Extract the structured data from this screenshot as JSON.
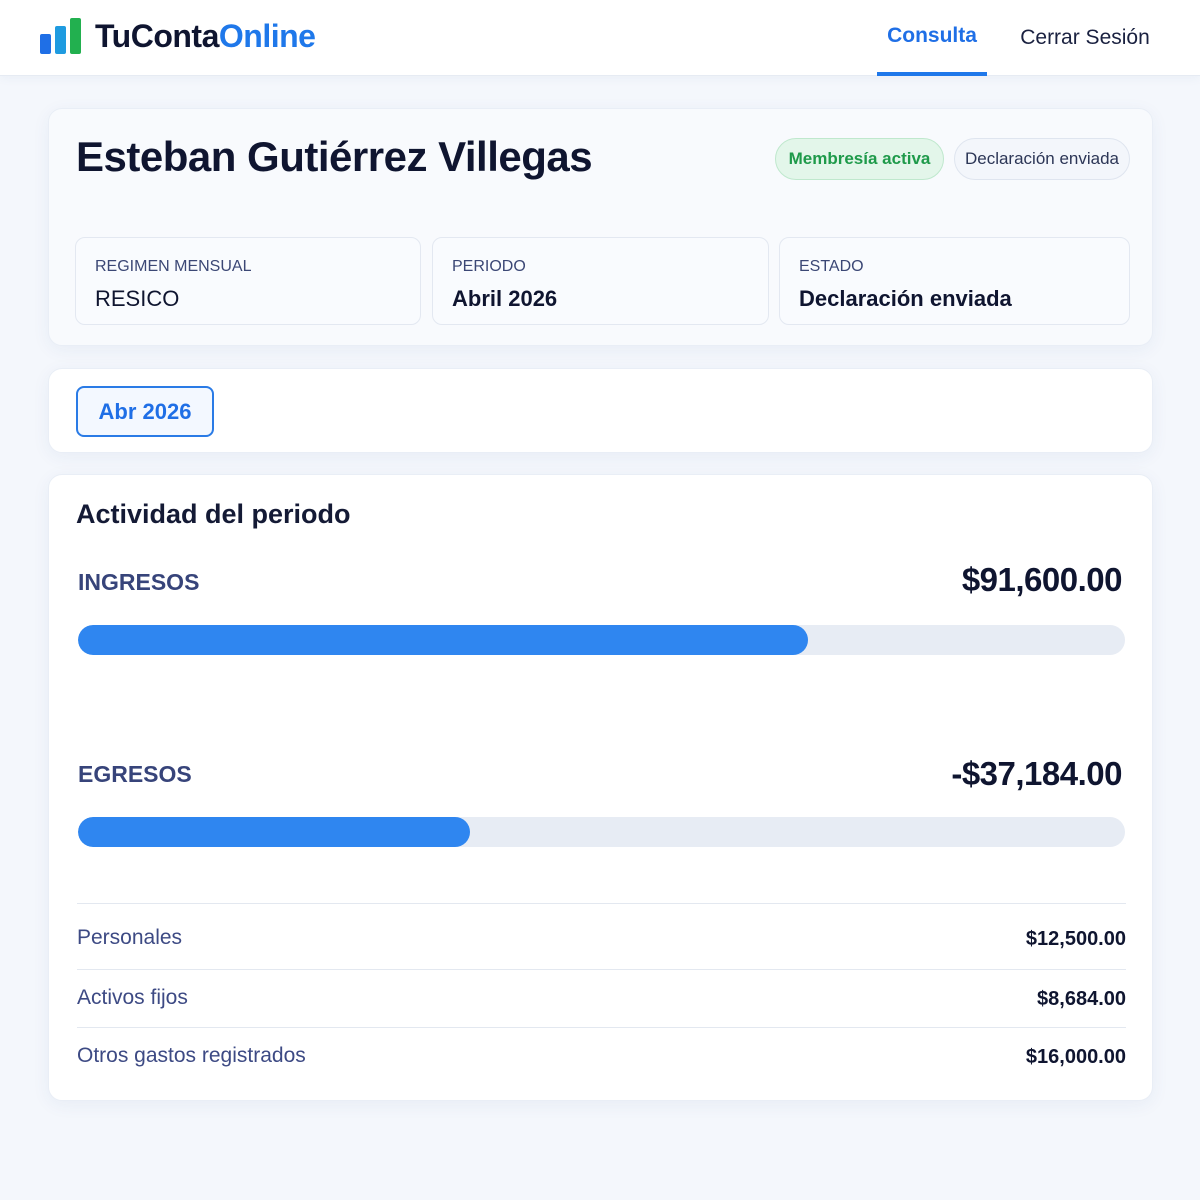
{
  "header": {
    "brand_part1": "TuConta",
    "brand_part2": "Online",
    "nav": {
      "consulta": "Consulta",
      "logout": "Cerrar Sesión"
    }
  },
  "client": {
    "name": "Esteban Gutiérrez Villegas",
    "badges": {
      "membership": "Membresía activa",
      "declaration": "Declaración enviada"
    },
    "info": [
      {
        "label": "REGIMEN MENSUAL",
        "value": "RESICO"
      },
      {
        "label": "PERIODO",
        "value": "Abril 2026"
      },
      {
        "label": "ESTADO",
        "value": "Declaración enviada"
      }
    ]
  },
  "period_selector": {
    "selected": "Abr 2026"
  },
  "activity": {
    "title": "Actividad del periodo",
    "income": {
      "label": "INGRESOS",
      "value": "$91,600.00",
      "bar_fraction": 0.697
    },
    "expenses": {
      "label": "EGRESOS",
      "value": "-$37,184.00",
      "bar_fraction": 0.374
    },
    "breakdown": [
      {
        "label": "Personales",
        "value": "$12,500.00"
      },
      {
        "label": "Activos fijos",
        "value": "$8,684.00"
      },
      {
        "label": "Otros gastos registrados",
        "value": "$16,000.00"
      }
    ]
  },
  "colors": {
    "accent": "#1f78ea",
    "bar_fill": "#2f86f0",
    "success": "#1e9a4a",
    "brand_dark": "#0f1530"
  }
}
